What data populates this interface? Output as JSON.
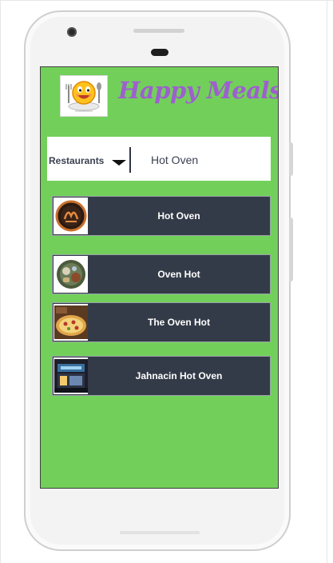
{
  "app": {
    "title": "Happy Meals"
  },
  "search": {
    "category": "Restaurants",
    "query": "Hot Oven"
  },
  "results": [
    {
      "name": "Hot Oven",
      "thumb_icon": "hot-oven-logo-icon"
    },
    {
      "name": "Oven Hot",
      "thumb_icon": "food-bowl-icon"
    },
    {
      "name": "The Oven Hot",
      "thumb_icon": "pizza-icon"
    },
    {
      "name": "Jahnacin Hot Oven",
      "thumb_icon": "storefront-icon"
    }
  ],
  "colors": {
    "screen_bg": "#72d05a",
    "title_purple": "#9e5fd0",
    "card_bg": "#343b48",
    "card_text": "#ffffff"
  }
}
